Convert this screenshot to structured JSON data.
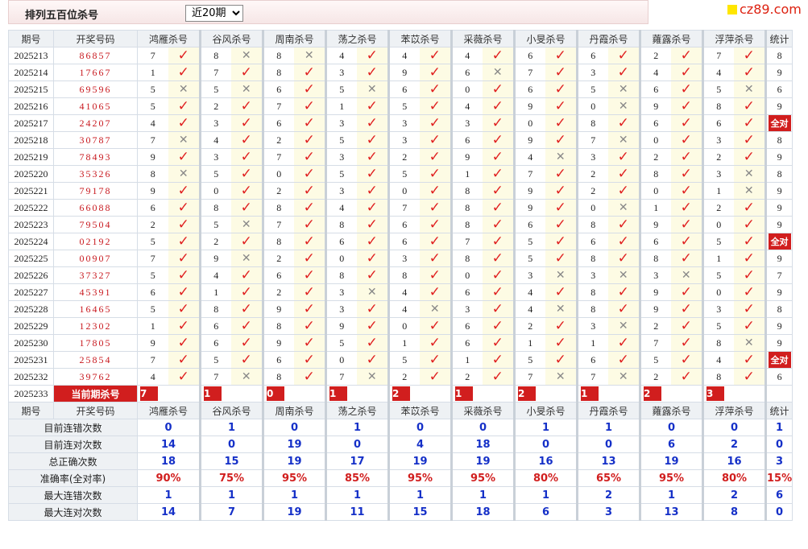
{
  "header": {
    "title": "排列五百位杀号",
    "period_select": "近20期",
    "period_options": [
      "近20期"
    ]
  },
  "logo": {
    "text": "cz89.com"
  },
  "columns": {
    "issue": "期号",
    "draw": "开奖号码",
    "experts": [
      "鸿雁杀号",
      "谷风杀号",
      "周南杀号",
      "荡之杀号",
      "苯苡杀号",
      "采薇杀号",
      "小旻杀号",
      "丹霞杀号",
      "蕹露杀号",
      "浮萍杀号"
    ],
    "stats": "统计"
  },
  "rows": [
    {
      "issue": "2025213",
      "draw": "86857",
      "kills": [
        7,
        8,
        8,
        4,
        4,
        4,
        6,
        6,
        2,
        7
      ],
      "marks": "YNNYYYYYYY",
      "count": "8"
    },
    {
      "issue": "2025214",
      "draw": "17667",
      "kills": [
        1,
        7,
        8,
        3,
        9,
        6,
        7,
        3,
        4,
        4
      ],
      "marks": "YYYYYNYYYY",
      "count": "9"
    },
    {
      "issue": "2025215",
      "draw": "69596",
      "kills": [
        5,
        5,
        6,
        5,
        6,
        0,
        6,
        5,
        6,
        5
      ],
      "marks": "NNYNYYYNYN",
      "count": "6"
    },
    {
      "issue": "2025216",
      "draw": "41065",
      "kills": [
        5,
        2,
        7,
        1,
        5,
        4,
        9,
        0,
        9,
        8
      ],
      "marks": "YYYYYYYNYY",
      "count": "9"
    },
    {
      "issue": "2025217",
      "draw": "24207",
      "kills": [
        4,
        3,
        6,
        3,
        3,
        3,
        0,
        8,
        6,
        6
      ],
      "marks": "YYYYYYYYYY",
      "count": "全对"
    },
    {
      "issue": "2025218",
      "draw": "30787",
      "kills": [
        7,
        4,
        2,
        5,
        3,
        6,
        9,
        7,
        0,
        3
      ],
      "marks": "NYYYYYYNYY",
      "count": "8"
    },
    {
      "issue": "2025219",
      "draw": "78493",
      "kills": [
        9,
        3,
        7,
        3,
        2,
        9,
        4,
        3,
        2,
        2
      ],
      "marks": "YYYYYYNYYY",
      "count": "9"
    },
    {
      "issue": "2025220",
      "draw": "35326",
      "kills": [
        8,
        5,
        0,
        5,
        5,
        1,
        7,
        2,
        8,
        3
      ],
      "marks": "NYYYYYYYYN",
      "count": "8"
    },
    {
      "issue": "2025221",
      "draw": "79178",
      "kills": [
        9,
        0,
        2,
        3,
        0,
        8,
        9,
        2,
        0,
        1
      ],
      "marks": "YYYYYYYYYN",
      "count": "9"
    },
    {
      "issue": "2025222",
      "draw": "66088",
      "kills": [
        6,
        8,
        8,
        4,
        7,
        8,
        9,
        0,
        1,
        2
      ],
      "marks": "YYYYYYYNYY",
      "count": "9"
    },
    {
      "issue": "2025223",
      "draw": "79504",
      "kills": [
        2,
        5,
        7,
        8,
        6,
        8,
        6,
        8,
        9,
        0
      ],
      "marks": "YNYYYYYYYY",
      "count": "9"
    },
    {
      "issue": "2025224",
      "draw": "02192",
      "kills": [
        5,
        2,
        8,
        6,
        6,
        7,
        5,
        6,
        6,
        5
      ],
      "marks": "YYYYYYYYYY",
      "count": "全对"
    },
    {
      "issue": "2025225",
      "draw": "00907",
      "kills": [
        7,
        9,
        2,
        0,
        3,
        8,
        5,
        8,
        8,
        1
      ],
      "marks": "YNYYYYYYYY",
      "count": "9"
    },
    {
      "issue": "2025226",
      "draw": "37327",
      "kills": [
        5,
        4,
        6,
        8,
        8,
        0,
        3,
        3,
        3,
        5
      ],
      "marks": "YYYYYYNNNY",
      "count": "7"
    },
    {
      "issue": "2025227",
      "draw": "45391",
      "kills": [
        6,
        1,
        2,
        3,
        4,
        6,
        4,
        8,
        9,
        0
      ],
      "marks": "YYYNYYYYYY",
      "count": "9"
    },
    {
      "issue": "2025228",
      "draw": "16465",
      "kills": [
        5,
        8,
        9,
        3,
        4,
        3,
        4,
        8,
        9,
        3
      ],
      "marks": "YYYYNYNYYY",
      "count": "8"
    },
    {
      "issue": "2025229",
      "draw": "12302",
      "kills": [
        1,
        6,
        8,
        9,
        0,
        6,
        2,
        3,
        2,
        5
      ],
      "marks": "YYYYYYYNYY",
      "count": "9"
    },
    {
      "issue": "2025230",
      "draw": "17805",
      "kills": [
        9,
        6,
        9,
        5,
        1,
        6,
        1,
        1,
        7,
        8
      ],
      "marks": "YYYYYYYYYN",
      "count": "9"
    },
    {
      "issue": "2025231",
      "draw": "25854",
      "kills": [
        7,
        5,
        6,
        0,
        5,
        1,
        5,
        6,
        5,
        4
      ],
      "marks": "YYYYYYYYYY",
      "count": "全对"
    },
    {
      "issue": "2025232",
      "draw": "39762",
      "kills": [
        4,
        7,
        8,
        7,
        2,
        2,
        7,
        7,
        2,
        8
      ],
      "marks": "YNYNYYNNYY",
      "count": "6"
    }
  ],
  "current": {
    "issue": "2025233",
    "label": "当前期杀号",
    "kills": [
      7,
      1,
      0,
      1,
      2,
      1,
      2,
      1,
      2,
      3
    ]
  },
  "stats": [
    {
      "label": "目前连错次数",
      "values": [
        "0",
        "1",
        "0",
        "1",
        "0",
        "0",
        "1",
        "1",
        "0",
        "0"
      ],
      "total": "1"
    },
    {
      "label": "目前连对次数",
      "values": [
        "14",
        "0",
        "19",
        "0",
        "4",
        "18",
        "0",
        "0",
        "6",
        "2"
      ],
      "total": "0"
    },
    {
      "label": "总正确次数",
      "values": [
        "18",
        "15",
        "19",
        "17",
        "19",
        "19",
        "16",
        "13",
        "19",
        "16"
      ],
      "total": "3"
    },
    {
      "label": "准确率(全对率)",
      "values": [
        "90%",
        "75%",
        "95%",
        "85%",
        "95%",
        "95%",
        "80%",
        "65%",
        "95%",
        "80%"
      ],
      "total": "15%",
      "pct": true
    },
    {
      "label": "最大连错次数",
      "values": [
        "1",
        "1",
        "1",
        "1",
        "1",
        "1",
        "1",
        "2",
        "1",
        "2"
      ],
      "total": "6"
    },
    {
      "label": "最大连对次数",
      "values": [
        "14",
        "7",
        "19",
        "11",
        "15",
        "18",
        "6",
        "3",
        "13",
        "8"
      ],
      "total": "0"
    }
  ],
  "colors": {
    "accent_red": "#d11e1e",
    "stat_blue": "#1530c8",
    "highlight": "#fdfbe4",
    "ok_mark": "#e02020"
  },
  "icons": {
    "correct": "check-mark-icon",
    "wrong": "cross-mark-icon"
  }
}
